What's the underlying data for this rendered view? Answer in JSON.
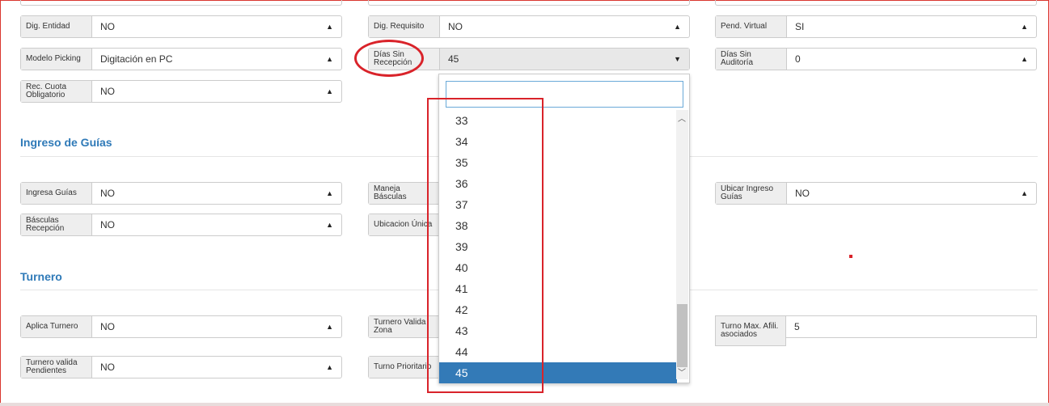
{
  "row1": {
    "dig_entidad": {
      "label": "Dig. Entidad",
      "value": "NO"
    },
    "dig_requisito": {
      "label": "Dig. Requisito",
      "value": "NO"
    },
    "pend_virtual": {
      "label": "Pend. Virtual",
      "value": "SI"
    }
  },
  "row2": {
    "modelo_picking": {
      "label": "Modelo Picking",
      "value": "Digitación en PC"
    },
    "dias_sin_recepcion": {
      "label": "Días Sin Recepción",
      "value": "45"
    },
    "dias_sin_auditoria": {
      "label": "Días Sin Auditoría",
      "value": "0"
    }
  },
  "row3": {
    "rec_cuota": {
      "label": "Rec. Cuota Obligatorio",
      "value": "NO"
    }
  },
  "sections": {
    "ingreso_guias": "Ingreso de Guías",
    "turnero": "Turnero"
  },
  "guias": {
    "ingresa_guias": {
      "label": "Ingresa Guías",
      "value": "NO"
    },
    "maneja_basculas": {
      "label": "Maneja Básculas",
      "value": ""
    },
    "ubicar_ingreso": {
      "label": "Ubicar Ingreso Guías",
      "value": "NO"
    },
    "basculas_recepcion": {
      "label": "Básculas Recepción",
      "value": "NO"
    },
    "ubicacion_unica": {
      "label": "Ubicacion Única",
      "value": ""
    }
  },
  "turnero": {
    "aplica_turnero": {
      "label": "Aplica Turnero",
      "value": "NO"
    },
    "turnero_valida_zona": {
      "label": "Turnero Valida Zona",
      "value": ""
    },
    "turno_max": {
      "label": "Turno Max. Afili. asociados",
      "value": "5"
    },
    "turnero_valida_pendientes": {
      "label": "Turnero valida Pendientes",
      "value": "NO"
    },
    "turno_prioritario": {
      "label": "Turno Prioritario",
      "value": ""
    }
  },
  "dropdown": {
    "search_value": "",
    "options": [
      "33",
      "34",
      "35",
      "36",
      "37",
      "38",
      "39",
      "40",
      "41",
      "42",
      "43",
      "44",
      "45"
    ],
    "selected": "45"
  },
  "icons": {
    "caret_up": "▲",
    "caret_down": "▼",
    "scroll_up": "chevron-up-icon",
    "scroll_down": "chevron-down-icon"
  },
  "colors": {
    "accent": "#337ab7",
    "section_title": "#2f7ab8",
    "annotation_red": "#d9232a"
  }
}
